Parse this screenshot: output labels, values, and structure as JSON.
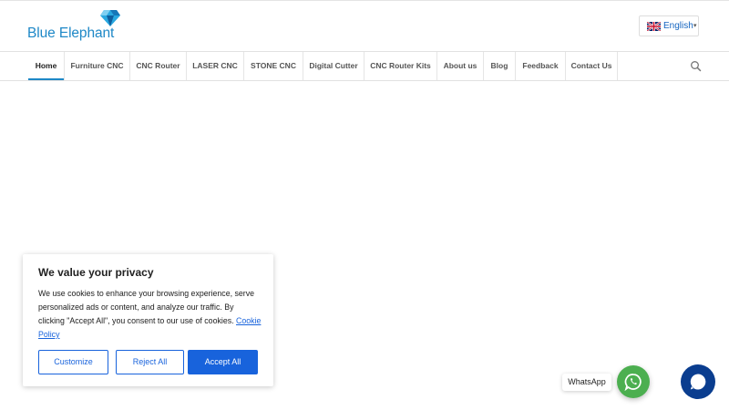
{
  "header": {
    "logo_text": "Blue Elephant",
    "language": {
      "label": "English",
      "caret": "▾"
    }
  },
  "nav": {
    "items": [
      {
        "label": "Home",
        "active": true
      },
      {
        "label": "Furniture CNC"
      },
      {
        "label": "CNC Router"
      },
      {
        "label": "LASER CNC"
      },
      {
        "label": "STONE CNC"
      },
      {
        "label": "Digital Cutter"
      },
      {
        "label": "CNC Router Kits"
      },
      {
        "label": "About us"
      },
      {
        "label": "Blog"
      },
      {
        "label": "Feedback"
      },
      {
        "label": "Contact Us"
      }
    ]
  },
  "cookie": {
    "title": "We value your privacy",
    "body": "We use cookies to enhance your browsing experience, serve personalized ads or content, and analyze our traffic. By clicking \"Accept All\", you consent to our use of cookies.",
    "policy_link": "Cookie Policy",
    "customize": "Customize",
    "reject": "Reject All",
    "accept": "Accept All"
  },
  "whatsapp": {
    "label": "WhatsApp"
  },
  "colors": {
    "brand": "#1e88c7",
    "cookie_accent": "#1863dc",
    "whatsapp_green": "#4caf50",
    "chat_navy": "#0a3d8f"
  },
  "icons": [
    "diamond-logo-icon",
    "uk-flag-icon",
    "search-icon",
    "whatsapp-icon",
    "chat-icon"
  ]
}
